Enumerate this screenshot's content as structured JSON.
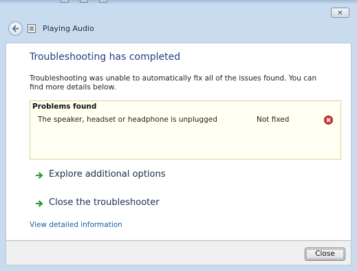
{
  "window": {
    "title": "Playing Audio",
    "close_glyph": "✕"
  },
  "main": {
    "heading": "Troubleshooting has completed",
    "description": "Troubleshooting was unable to automatically fix all of the issues found. You can find more details below.",
    "problems": {
      "header": "Problems found",
      "items": [
        {
          "name": "The speaker, headset or headphone is unplugged",
          "status": "Not fixed",
          "status_icon": "error-icon",
          "status_color": "#c0392b"
        }
      ]
    },
    "options": [
      {
        "label": "Explore additional options",
        "icon": "green-arrow-icon"
      },
      {
        "label": "Close the troubleshooter",
        "icon": "green-arrow-icon"
      }
    ],
    "details_link": "View detailed information"
  },
  "footer": {
    "close_label": "Close"
  },
  "colors": {
    "heading": "#1f3f86",
    "link": "#1b5cb0",
    "arrow": "#2e9a2e",
    "problems_border": "#d6d59a"
  }
}
